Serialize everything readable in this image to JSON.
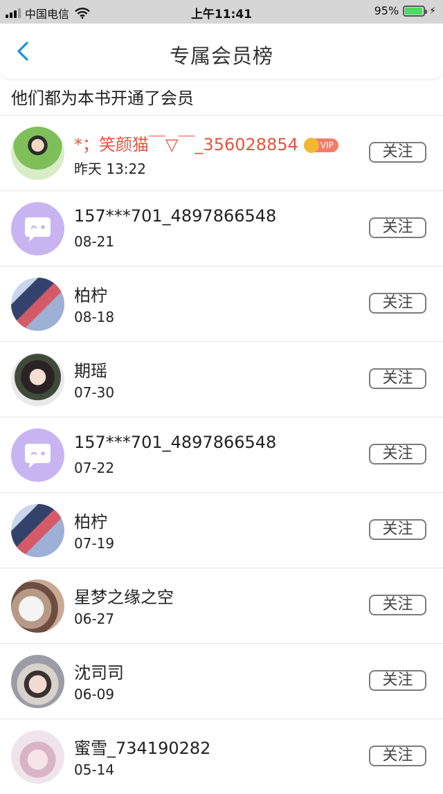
{
  "status_bar": {
    "carrier": "中国电信",
    "time": "上午11:41",
    "battery": "95%",
    "battery_level": 0.95,
    "icons": [
      "signal-icon",
      "wifi-icon",
      "battery-icon",
      "charging-icon"
    ]
  },
  "nav": {
    "title": "专属会员榜",
    "back_icon": "chevron-left-icon"
  },
  "subtitle": "他们都为本书开通了会员",
  "follow_label": "关注",
  "vip_badge": "VIP",
  "colors": {
    "accent_back": "#1a8fe3",
    "vip_name": "#e5533b",
    "vip_badge": "#f47c6a",
    "default_avatar": "#c9b4f2"
  },
  "members": [
    {
      "name": "*；笑颜猫￣▽￣_356028854",
      "date": "昨天 13:22",
      "vip": true
    },
    {
      "name": "157***701_4897866548",
      "date": "08-21",
      "vip": false
    },
    {
      "name": "柏柠",
      "date": "08-18",
      "vip": false
    },
    {
      "name": "期瑶",
      "date": "07-30",
      "vip": false
    },
    {
      "name": "157***701_4897866548",
      "date": "07-22",
      "vip": false
    },
    {
      "name": "柏柠",
      "date": "07-19",
      "vip": false
    },
    {
      "name": "星梦之缘之空",
      "date": "06-27",
      "vip": false
    },
    {
      "name": "沈司司",
      "date": "06-09",
      "vip": false
    },
    {
      "name": "蜜雪_734190282",
      "date": "05-14",
      "vip": false
    }
  ]
}
